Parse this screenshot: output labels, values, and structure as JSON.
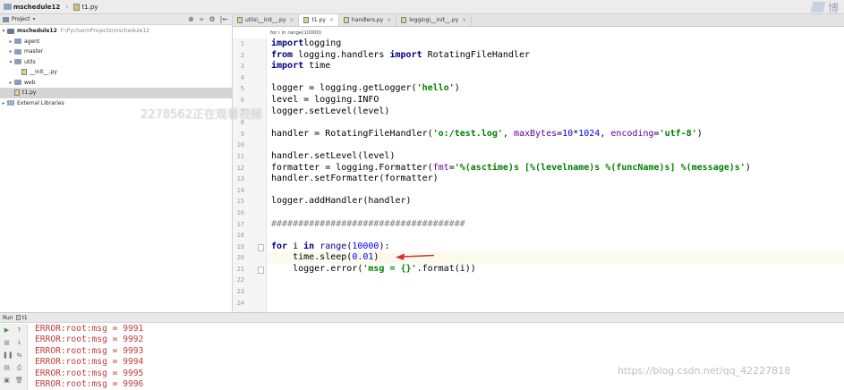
{
  "navbar": {
    "project": "mschedule12",
    "file": "t1.py",
    "logo_text": "博"
  },
  "project_panel": {
    "title": "Project",
    "dropdown": "▾",
    "tools": [
      "⊕",
      "÷",
      "⚙",
      "|←"
    ],
    "tree": [
      {
        "label": "mschedule12",
        "path": "F:\\PycharmProjects\\mschedule12",
        "type": "root",
        "arrow": "▾"
      },
      {
        "label": "agent",
        "type": "folder",
        "arrow": "▸"
      },
      {
        "label": "master",
        "type": "folder",
        "arrow": "▸"
      },
      {
        "label": "utils",
        "type": "folder",
        "arrow": "▾"
      },
      {
        "label": "__init__.py",
        "type": "py"
      },
      {
        "label": "web",
        "type": "folder",
        "arrow": "▸"
      },
      {
        "label": "t1.py",
        "type": "py"
      },
      {
        "label": "External Libraries",
        "type": "lib",
        "arrow": "▸"
      }
    ]
  },
  "editor": {
    "tabs": [
      {
        "label": "utils\\__init__.py",
        "active": false
      },
      {
        "label": "t1.py",
        "active": true
      },
      {
        "label": "handlers.py",
        "active": false
      },
      {
        "label": "logging\\__init__.py",
        "active": false
      }
    ],
    "tab_close": "×",
    "breadcrumb": "for i in range(10000)",
    "line_numbers": [
      "1",
      "2",
      "3",
      "4",
      "5",
      "6",
      "7",
      "8",
      "9",
      "10",
      "11",
      "12",
      "13",
      "14",
      "15",
      "16",
      "17",
      "18",
      "19",
      "20",
      "21",
      "22",
      "23",
      "24"
    ],
    "current_line": 20
  },
  "overlay": {
    "text": "2278562正在观看视频",
    "watermark": "https://blog.csdn.net/qq_42227818"
  },
  "run": {
    "label": "Run",
    "config": "t1",
    "console": [
      "ERROR:root:msg = 9991",
      "ERROR:root:msg = 9992",
      "ERROR:root:msg = 9993",
      "ERROR:root:msg = 9994",
      "ERROR:root:msg = 9995",
      "ERROR:root:msg = 9996"
    ]
  },
  "colors": {
    "keyword": "#000080",
    "string": "#008000",
    "number": "#0000ff",
    "param": "#660099",
    "console_error": "#c53a3a",
    "current_line_bg": "#fcfaed",
    "arrow": "#e03030"
  },
  "icons": [
    "folder-icon",
    "python-file-icon",
    "library-icon",
    "play-icon",
    "stop-icon",
    "settings-icon"
  ]
}
